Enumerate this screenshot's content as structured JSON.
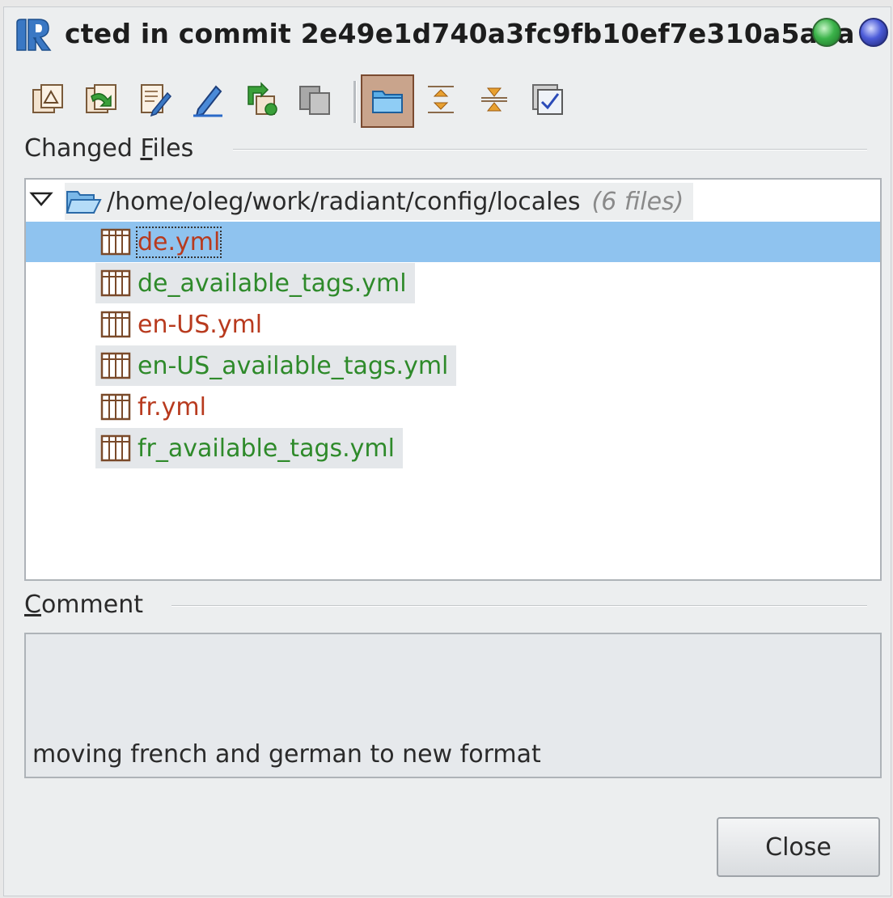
{
  "window": {
    "title": "cted in commit 2e49e1d740a3fc9fb10ef7e310a5a5a"
  },
  "toolbar": {
    "buttons": [
      {
        "icon": "show-diff-icon"
      },
      {
        "icon": "revert-changes-icon"
      },
      {
        "icon": "edit-source-icon"
      },
      {
        "icon": "edit-pencil-icon"
      },
      {
        "icon": "refresh-icon"
      },
      {
        "icon": "copy-icon"
      },
      {
        "icon": "group-by-directory-icon",
        "active": true
      },
      {
        "icon": "expand-all-icon"
      },
      {
        "icon": "collapse-all-icon"
      },
      {
        "icon": "select-all-icon"
      }
    ]
  },
  "changed_files": {
    "label_prefix": "Changed ",
    "label_mnemonic": "F",
    "label_suffix": "iles",
    "root": {
      "path": "/home/oleg/work/radiant/config/locales",
      "count": "(6 files)"
    },
    "files": [
      {
        "name": "de.yml",
        "status": "modified",
        "selected": true
      },
      {
        "name": "de_available_tags.yml",
        "status": "added"
      },
      {
        "name": "en-US.yml",
        "status": "modified"
      },
      {
        "name": "en-US_available_tags.yml",
        "status": "added"
      },
      {
        "name": "fr.yml",
        "status": "modified"
      },
      {
        "name": "fr_available_tags.yml",
        "status": "added"
      }
    ]
  },
  "comment": {
    "label_mnemonic": "C",
    "label_suffix": "omment",
    "text": "moving french and german to new format"
  },
  "actions": {
    "close_label": "Close"
  },
  "colors": {
    "modified": "#b83a1e",
    "added": "#2e8a2a",
    "selection": "#8fc3ef"
  }
}
